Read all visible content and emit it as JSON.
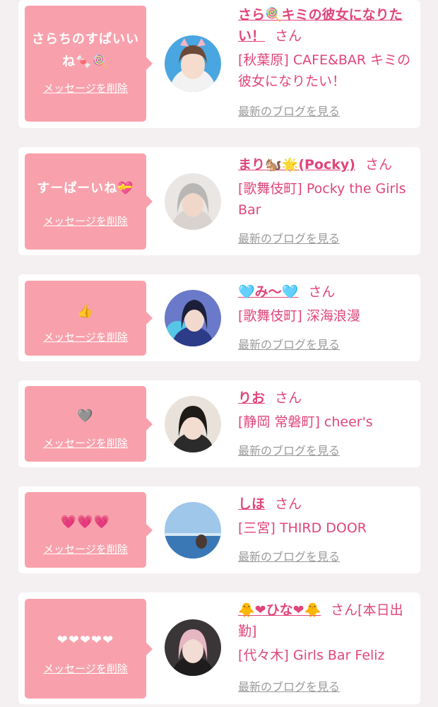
{
  "delete_label": "メッセージを削除",
  "blog_label": "最新のブログを見る",
  "san_label": "さん",
  "colors": {
    "background": "#f4f0f1",
    "card": "#ffffff",
    "bubble": "#f8a1ac",
    "accent": "#e0457b",
    "link_gray": "#9a9a9a"
  },
  "items": [
    {
      "message": "さらちのすぱいいね🍬🍭",
      "name": "さら🍭キミの彼女になりたい！",
      "suffix": "さん",
      "shop": "[秋葉原] CAFE&BAR キミの彼女になりたい！",
      "avatar_icon": "profile-photo-girl-cat-ears"
    },
    {
      "message": "すーぱーいね💝",
      "name": "まり🐿️🌟(Pocky)",
      "suffix": "さん",
      "shop": "[歌舞伎町] Pocky the Girls Bar",
      "avatar_icon": "profile-photo-girl-silver-hair"
    },
    {
      "message": "👍",
      "name": "🩵み〜🩵",
      "suffix": "さん",
      "shop": "[歌舞伎町] 深海浪漫",
      "avatar_icon": "profile-photo-girl-blue-outfit"
    },
    {
      "message": "🩶",
      "name": "りお",
      "suffix": "さん",
      "shop": "[静岡 常磐町] cheer's",
      "avatar_icon": "profile-photo-girl-dark-hair"
    },
    {
      "message": "💗💗💗",
      "name": "しほ",
      "suffix": "さん",
      "shop": "[三宮] THIRD DOOR",
      "avatar_icon": "profile-photo-pool-sky"
    },
    {
      "message": "❤❤❤❤❤",
      "name": "🐥❤ひな❤🐥",
      "suffix": "さん[本日出勤]",
      "shop": "[代々木] Girls Bar Feliz",
      "avatar_icon": "profile-photo-girl-pink-hair"
    }
  ]
}
